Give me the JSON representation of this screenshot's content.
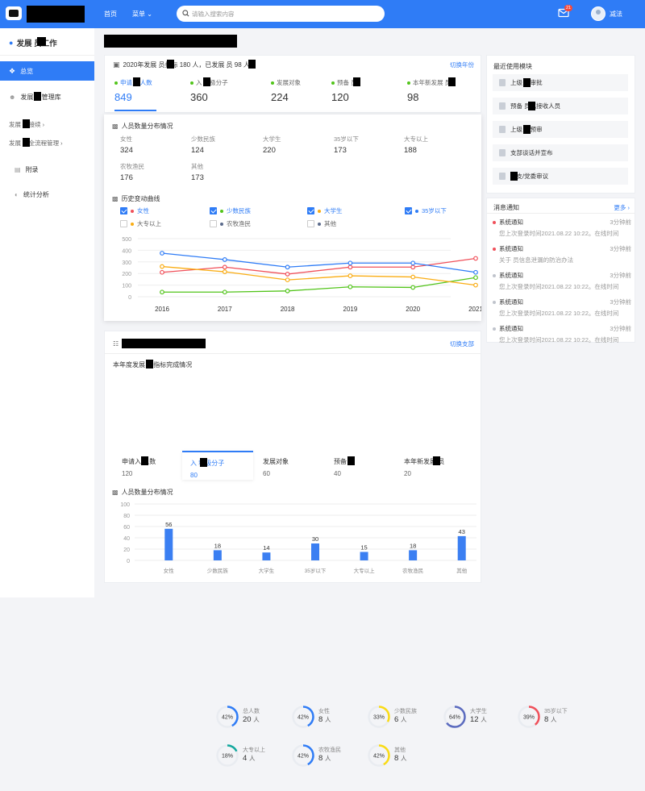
{
  "topbar": {
    "nav": [
      "首页",
      "菜单"
    ],
    "search_placeholder": "请输入搜索内容",
    "mail_badge": "21",
    "user_name": "减法"
  },
  "sidebar": {
    "title": "发展 员工作",
    "items": [
      {
        "label": "总览",
        "active": true
      },
      {
        "label": "发展 员管理库"
      }
    ],
    "subs": [
      "发展 员接续 ›",
      "发展 员全流程管理 ›"
    ],
    "items2": [
      {
        "label": "附录"
      },
      {
        "label": "统计分析"
      }
    ]
  },
  "summary": {
    "header": "2020年发展 员指标 180 人，已发展 员 98 人",
    "switch_label": "切换年份",
    "stats": [
      {
        "label": "申请入 人数",
        "value": "849"
      },
      {
        "label": "入 积极分子",
        "value": "360"
      },
      {
        "label": "发展对象",
        "value": "224"
      },
      {
        "label": "预备 员",
        "value": "120"
      },
      {
        "label": "本年新发展 员",
        "value": "98"
      }
    ]
  },
  "distribution": {
    "title": "人员数量分布情况",
    "cells": [
      {
        "label": "女性",
        "value": "324"
      },
      {
        "label": "少数民族",
        "value": "124"
      },
      {
        "label": "大学生",
        "value": "220"
      },
      {
        "label": "35岁以下",
        "value": "173"
      },
      {
        "label": "大专以上",
        "value": "188"
      },
      {
        "label": "农牧渔民",
        "value": "176"
      },
      {
        "label": "其他",
        "value": "173"
      }
    ]
  },
  "history": {
    "title": "历史变动曲线",
    "legend": [
      {
        "label": "女性",
        "color": "#f0505a",
        "checked": true
      },
      {
        "label": "少数民族",
        "color": "#52c41a",
        "checked": true
      },
      {
        "label": "大学生",
        "color": "#faad14",
        "checked": true
      },
      {
        "label": "35岁以下",
        "color": "#2f7cf6",
        "checked": true
      },
      {
        "label": "大专以上",
        "color": "#faad14",
        "checked": false
      },
      {
        "label": "农牧渔民",
        "color": "#5b6b8c",
        "checked": false
      },
      {
        "label": "其他",
        "color": "#5b6b8c",
        "checked": false
      }
    ]
  },
  "chart_data": [
    {
      "type": "line",
      "title": "历史变动曲线",
      "x": [
        "2016",
        "2017",
        "2018",
        "2019",
        "2020",
        "2021"
      ],
      "ylim": [
        0,
        500
      ],
      "yticks": [
        "500",
        "400",
        "300",
        "200",
        "100",
        "0"
      ],
      "series": [
        {
          "name": "女性",
          "color": "#f0505a",
          "values": [
            210,
            255,
            195,
            255,
            255,
            330
          ]
        },
        {
          "name": "少数民族",
          "color": "#52c41a",
          "values": [
            40,
            40,
            50,
            85,
            80,
            165
          ]
        },
        {
          "name": "大学生",
          "color": "#faad14",
          "values": [
            260,
            215,
            145,
            180,
            170,
            100
          ]
        },
        {
          "name": "35岁以下",
          "color": "#2f7cf6",
          "values": [
            375,
            320,
            255,
            290,
            290,
            210
          ]
        }
      ]
    },
    {
      "type": "bar",
      "title": "人员数量分布情况",
      "categories": [
        "女性",
        "少数民族",
        "大学生",
        "35岁以下",
        "大专以上",
        "农牧渔民",
        "其他"
      ],
      "values": [
        56,
        18,
        14,
        30,
        15,
        18,
        43
      ],
      "ylim": [
        0,
        100
      ],
      "yticks": [
        "100",
        "80",
        "60",
        "40",
        "20",
        "0"
      ]
    }
  ],
  "org": {
    "switch_label": "切换支部",
    "subtitle": "本年度发展 员指标完成情况",
    "donuts": [
      {
        "label": "总人数",
        "pct": "42%",
        "ratio": 0.42,
        "value": "20",
        "unit": "人",
        "color": "#2f7cf6"
      },
      {
        "label": "女性",
        "pct": "42%",
        "ratio": 0.42,
        "value": "8",
        "unit": "人",
        "color": "#2f7cf6"
      },
      {
        "label": "少数民族",
        "pct": "33%",
        "ratio": 0.33,
        "value": "6",
        "unit": "人",
        "color": "#fadb14"
      },
      {
        "label": "大学生",
        "pct": "64%",
        "ratio": 0.64,
        "value": "12",
        "unit": "人",
        "color": "#5b6bbf"
      },
      {
        "label": "35岁以下",
        "pct": "39%",
        "ratio": 0.39,
        "value": "8",
        "unit": "人",
        "color": "#f0505a"
      },
      {
        "label": "大专以上",
        "pct": "18%",
        "ratio": 0.18,
        "value": "4",
        "unit": "人",
        "color": "#13a89e"
      },
      {
        "label": "农牧渔民",
        "pct": "42%",
        "ratio": 0.42,
        "value": "8",
        "unit": "人",
        "color": "#2f7cf6"
      },
      {
        "label": "其他",
        "pct": "42%",
        "ratio": 0.42,
        "value": "8",
        "unit": "人",
        "color": "#fadb14"
      }
    ],
    "tabs": [
      {
        "label": "申请入 人数",
        "value": "120"
      },
      {
        "label": "入 积极分子",
        "value": "80",
        "active": true
      },
      {
        "label": "发展对象",
        "value": "60"
      },
      {
        "label": "预备 员",
        "value": "40"
      },
      {
        "label": "本年新发展 员",
        "value": "20"
      }
    ],
    "bar_title": "人员数量分布情况"
  },
  "recent": {
    "title": "最近使用模块",
    "modules": [
      "上级 委审批",
      "预备 员拟接收人员",
      "上级 委预审",
      "支部谈话并宣布",
      " 总支/党委审议"
    ]
  },
  "notices": {
    "title": "消息通知",
    "more": "更多 ›",
    "items": [
      {
        "title": "系统通知",
        "time": "3分钟前",
        "body": "您上次登录时间2021.08.22 10:22。在线时间",
        "dot": "#f0505a"
      },
      {
        "title": "系统通知",
        "time": "3分钟前",
        "body": "关于 员信息泄漏的防治办法",
        "dot": "#f0505a"
      },
      {
        "title": "系统通知",
        "time": "3分钟前",
        "body": "您上次登录时间2021.08.22 10:22。在线时间",
        "dot": "#c0c4cc"
      },
      {
        "title": "系统通知",
        "time": "3分钟前",
        "body": "您上次登录时间2021.08.22 10:22。在线时间",
        "dot": "#c0c4cc"
      },
      {
        "title": "系统通知",
        "time": "3分钟前",
        "body": "您上次登录时间2021.08.22 10:22。在线时间",
        "dot": "#c0c4cc"
      }
    ]
  }
}
